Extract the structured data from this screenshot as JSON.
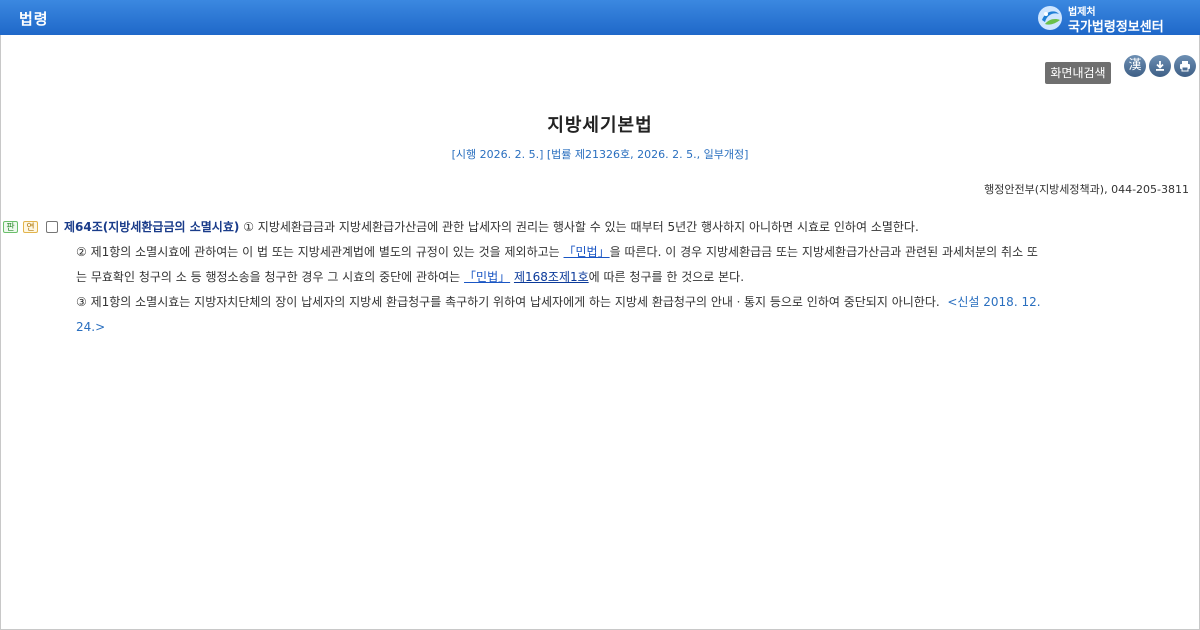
{
  "header": {
    "title": "법령",
    "brand_ministry": "법제처",
    "brand_center": "국가법령정보센터"
  },
  "toolbar": {
    "search_label": "화면내검색",
    "hanja_label": "漢",
    "icons": [
      "download-icon",
      "print-icon"
    ]
  },
  "document": {
    "title": "지방세기본법",
    "meta": "[시행 2026. 2. 5.] [법률 제21326호, 2026. 2. 5., 일부개정]",
    "contact": "행정안전부(지방세정책과), 044-205-3811"
  },
  "article": {
    "tag_pan": "판",
    "tag_yeon": "연",
    "title": "제64조(지방세환급금의 소멸시효)",
    "p1": "① 지방세환급금과 지방세환급가산금에 관한 납세자의 권리는 행사할 수 있는 때부터 5년간 행사하지 아니하면 시효로 인하여 소멸한다.",
    "p2_a": "② 제1항의 소멸시효에 관하여는 이 법 또는 지방세관계법에 별도의 규정이 있는 것을 제외하고는 ",
    "p2_link1": "「민법」",
    "p2_b": "을 따른다. 이 경우 지방세환급금 또는 지방세환급가산금과 관련된 과세처분의 취소 또",
    "p2_c": "는 무효확인 청구의 소 등 행정소송을 청구한 경우 그 시효의 중단에 관하여는 ",
    "p2_link2": "「민법」",
    "p2_link3": "제168조제1호",
    "p2_d": "에 따른 청구를 한 것으로 본다.",
    "p3_a": "③ 제1항의 소멸시효는 지방자치단체의 장이 납세자의 지방세 환급청구를 촉구하기 위하여 납세자에게 하는 지방세 환급청구의 안내ㆍ통지 등으로 인하여 중단되지 아니한다.",
    "p3_note1": "<신설 2018. 12.",
    "p3_note2": "24.>"
  },
  "colors": {
    "header_blue": "#1f68c9",
    "link_blue": "#1a56c4",
    "meta_blue": "#2a6fbf",
    "article_title": "#1a3c8a"
  }
}
